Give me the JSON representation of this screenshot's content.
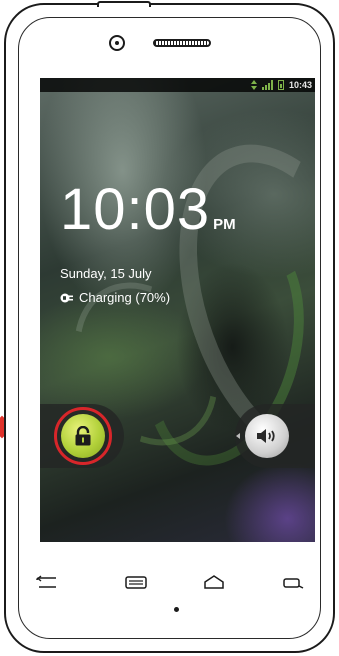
{
  "status_bar": {
    "time": "10:43",
    "icons": [
      "data-transfer-icon",
      "signal-icon",
      "battery-icon"
    ],
    "accent_color": "#7fb34a"
  },
  "lockscreen": {
    "time": "10:03",
    "ampm": "PM",
    "date": "Sunday, 15 July",
    "charging_text": "Charging (70%)",
    "battery_level_percent": 70
  },
  "controls": {
    "unlock_icon": "unlock-icon",
    "unlock_ring_color": "#d8262a",
    "unlock_color": "#b2d13a",
    "sound_icon": "speaker-icon"
  },
  "nav_keys": [
    "back-icon",
    "menu-icon",
    "home-icon",
    "search-icon"
  ]
}
